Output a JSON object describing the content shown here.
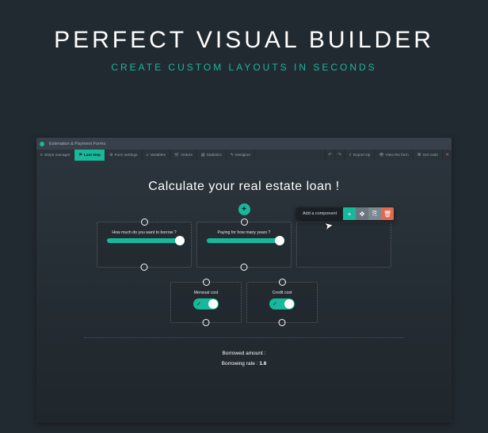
{
  "hero": {
    "title": "PERFECT VISUAL BUILDER",
    "subtitle": "CREATE CUSTOM LAYOUTS IN SECONDS"
  },
  "window": {
    "title": "Estimation & Payment Forms"
  },
  "tabs": {
    "steps_manager": "Steps manager",
    "last_step": "Last step",
    "form settings": "Form settings",
    "variables": "Variables",
    "orders": "Orders",
    "statistics": "Statistics",
    "designer": "Designer"
  },
  "right_buttons": {
    "export": "Export zip",
    "preview": "View the form",
    "get_code": "Get code"
  },
  "icons": {
    "undo": "↶",
    "redo": "↷",
    "close": "✕"
  },
  "form": {
    "heading": "Calculate your real estate loan !",
    "add_component": "Add a component",
    "card_borrow": "How much do you want to borrow ?",
    "card_years": "Paying for how many years ?",
    "card_mensual": "Mensual cost",
    "card_credit": "Credit cost",
    "summary_amount": "Borrowed amount :",
    "summary_rate_label": "Borrowing rate :",
    "summary_rate_value": "1.6"
  },
  "popover": {
    "plus": "+",
    "move": "✥",
    "copy": "⎘",
    "trash": "🗑"
  }
}
